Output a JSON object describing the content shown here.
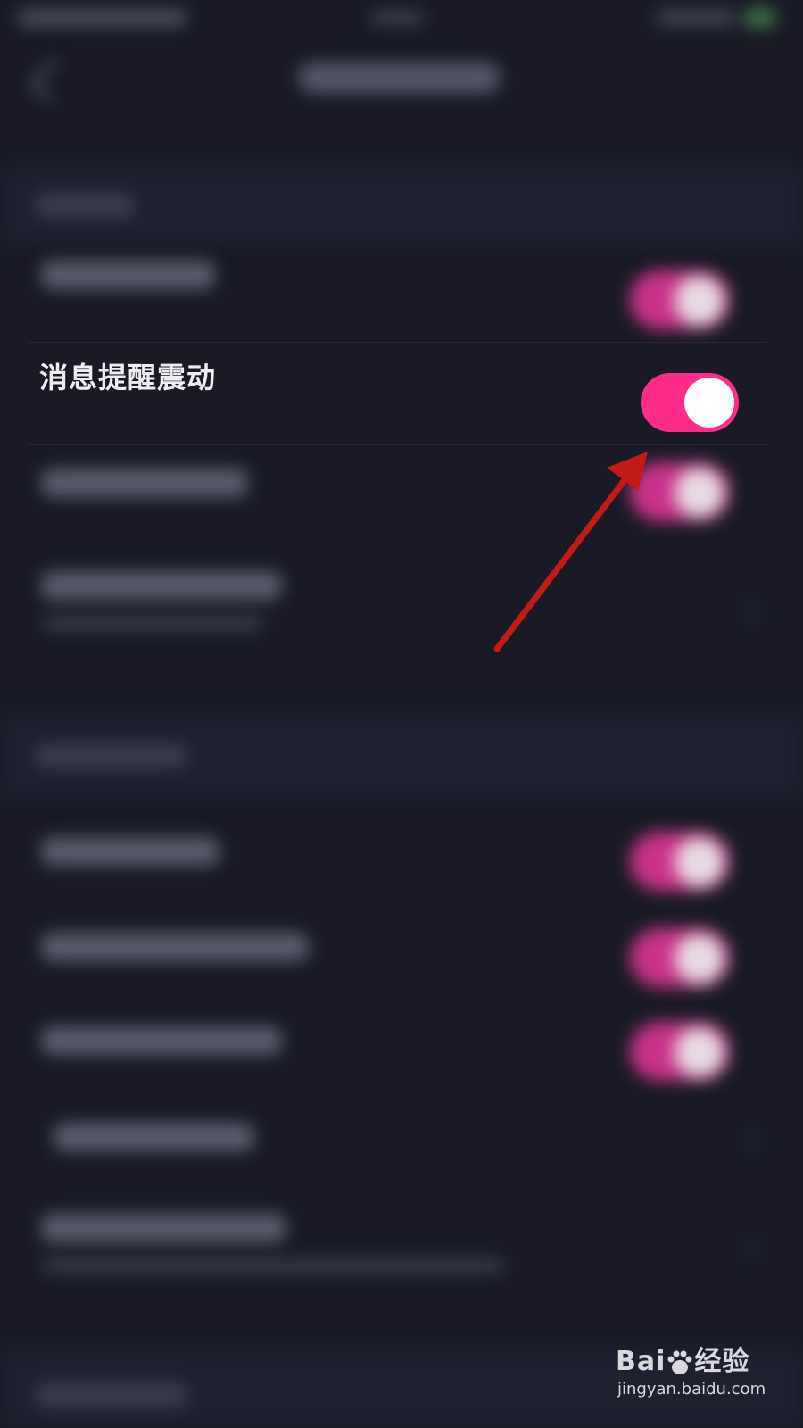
{
  "setting": {
    "label": "消息提醒震动",
    "enabled": true
  },
  "colors": {
    "background": "#191a26",
    "toggle_on": "#fe2c8a",
    "annotation_arrow": "#c21a17"
  },
  "watermark": {
    "logo_prefix": "Bai",
    "logo_suffix": "经验",
    "url": "jingyan.baidu.com"
  },
  "icons": [
    "back-arrow-icon",
    "chevron-right-icon",
    "annotation-arrow-icon",
    "baidu-paw-icon"
  ]
}
